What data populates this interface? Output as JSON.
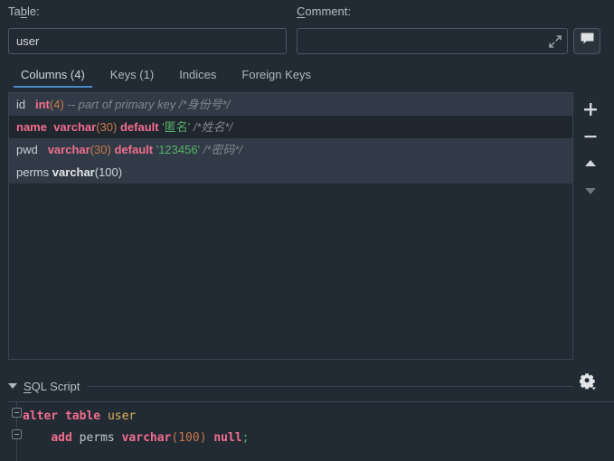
{
  "dialog": {
    "table_label": "Table:",
    "table_label_mnemonic": "b",
    "comment_label": "Comment:",
    "comment_label_mnemonic": "C"
  },
  "table_field": {
    "value": "user",
    "placeholder": ""
  },
  "comment_field": {
    "value": "",
    "placeholder": "",
    "expand_icon": "expand-arrows-icon",
    "bubble_button_icon": "speech-bubble-icon"
  },
  "tabs": [
    {
      "label": "Columns (4)",
      "active": true
    },
    {
      "label": "Keys (1)",
      "active": false
    },
    {
      "label": "Indices",
      "active": false
    },
    {
      "label": "Foreign Keys",
      "active": false
    }
  ],
  "columns": [
    {
      "name": "id",
      "selected": false,
      "alt": true,
      "tokens": [
        {
          "text": "id",
          "style": "t-name"
        },
        {
          "text": "   ",
          "style": "t-plain"
        },
        {
          "text": "int",
          "style": "t-type"
        },
        {
          "text": "(",
          "style": "t-paren"
        },
        {
          "text": "4",
          "style": "t-num"
        },
        {
          "text": ")",
          "style": "t-paren"
        },
        {
          "text": " ",
          "style": "t-plain"
        },
        {
          "text": "-- part of primary key /*身份号*/",
          "style": "t-comment"
        }
      ]
    },
    {
      "name": "name",
      "selected": true,
      "alt": false,
      "tokens": [
        {
          "text": "name",
          "style": "t-name-sel"
        },
        {
          "text": "  ",
          "style": "t-plain"
        },
        {
          "text": "varchar",
          "style": "t-type"
        },
        {
          "text": "(",
          "style": "t-paren"
        },
        {
          "text": "30",
          "style": "t-num"
        },
        {
          "text": ")",
          "style": "t-paren"
        },
        {
          "text": " ",
          "style": "t-plain"
        },
        {
          "text": "default",
          "style": "t-kw"
        },
        {
          "text": " ",
          "style": "t-plain"
        },
        {
          "text": "'匿名'",
          "style": "t-str"
        },
        {
          "text": " ",
          "style": "t-plain"
        },
        {
          "text": "/*姓名*/",
          "style": "t-comment"
        }
      ]
    },
    {
      "name": "pwd",
      "selected": false,
      "alt": true,
      "tokens": [
        {
          "text": "pwd",
          "style": "t-name"
        },
        {
          "text": "   ",
          "style": "t-plain"
        },
        {
          "text": "varchar",
          "style": "t-type"
        },
        {
          "text": "(",
          "style": "t-paren"
        },
        {
          "text": "30",
          "style": "t-num"
        },
        {
          "text": ")",
          "style": "t-paren"
        },
        {
          "text": " ",
          "style": "t-plain"
        },
        {
          "text": "default",
          "style": "t-kw"
        },
        {
          "text": " ",
          "style": "t-plain"
        },
        {
          "text": "'123456'",
          "style": "t-str"
        },
        {
          "text": " ",
          "style": "t-plain"
        },
        {
          "text": "/*密码*/",
          "style": "t-comment"
        }
      ]
    },
    {
      "name": "perms",
      "selected": false,
      "alt": true,
      "tokens": [
        {
          "text": "perms",
          "style": "t-plain"
        },
        {
          "text": " ",
          "style": "t-plain"
        },
        {
          "text": "varchar",
          "style": "t-typeplain"
        },
        {
          "text": "(100)",
          "style": "t-plain"
        }
      ]
    }
  ],
  "list_toolbar": [
    {
      "icon": "plus-icon",
      "name": "add-column-button",
      "enabled": true
    },
    {
      "icon": "minus-icon",
      "name": "remove-column-button",
      "enabled": true
    },
    {
      "icon": "move-up-icon",
      "name": "move-column-up-button",
      "enabled": true
    },
    {
      "icon": "move-down-icon",
      "name": "move-column-down-button",
      "enabled": false
    }
  ],
  "sql_section": {
    "title": "SQL Script",
    "title_mnemonic": "S",
    "collapse_icon": "chevron-down-icon",
    "settings_icon": "gear-icon",
    "code_lines": [
      {
        "tokens": [
          {
            "text": "alter",
            "style": "s-kw"
          },
          {
            "text": " ",
            "style": "s-ident"
          },
          {
            "text": "table",
            "style": "s-kw"
          },
          {
            "text": " ",
            "style": "s-ident"
          },
          {
            "text": "user",
            "style": "s-tbl"
          }
        ]
      },
      {
        "tokens": [
          {
            "text": "    ",
            "style": "s-ident"
          },
          {
            "text": "add",
            "style": "s-kw"
          },
          {
            "text": " ",
            "style": "s-ident"
          },
          {
            "text": "perms",
            "style": "s-ident"
          },
          {
            "text": " ",
            "style": "s-ident"
          },
          {
            "text": "varchar",
            "style": "s-kw"
          },
          {
            "text": "(",
            "style": "s-paren"
          },
          {
            "text": "100",
            "style": "s-num"
          },
          {
            "text": ")",
            "style": "s-paren"
          },
          {
            "text": " ",
            "style": "s-ident"
          },
          {
            "text": "null",
            "style": "s-kw"
          },
          {
            "text": ";",
            "style": "s-semi"
          }
        ]
      }
    ]
  },
  "colors": {
    "background": "#222A33",
    "row_alt": "#313B47",
    "row_selected": "#20262E",
    "accent": "#4A88C7",
    "keyword": "#F26E8E",
    "number": "#C9784A",
    "string": "#58B06A",
    "comment": "#7E878F",
    "table_name": "#D9B35B",
    "border": "#3C4450"
  }
}
